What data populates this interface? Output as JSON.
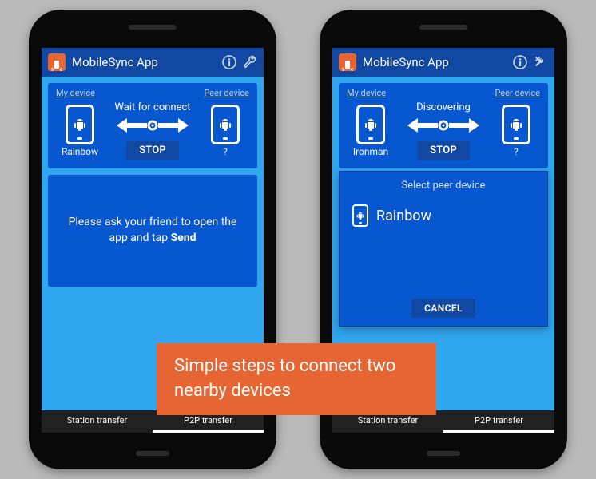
{
  "app": {
    "title": "MobileSync App"
  },
  "labels": {
    "my_device": "My device",
    "peer_device": "Peer device",
    "stop": "STOP",
    "cancel": "CANCEL"
  },
  "tabs": {
    "station": "Station transfer",
    "p2p": "P2P transfer"
  },
  "left": {
    "status": "Wait for connect",
    "my_name": "Rainbow",
    "peer_name": "?",
    "msg_pre": "Please ask your friend to open the app and tap ",
    "msg_bold": "Send"
  },
  "right": {
    "status": "Discovering",
    "my_name": "Ironman",
    "peer_name": "?",
    "dialog_title": "Select peer device",
    "dialog_item": "Rainbow"
  },
  "caption": "Simple steps to connect two nearby devices"
}
